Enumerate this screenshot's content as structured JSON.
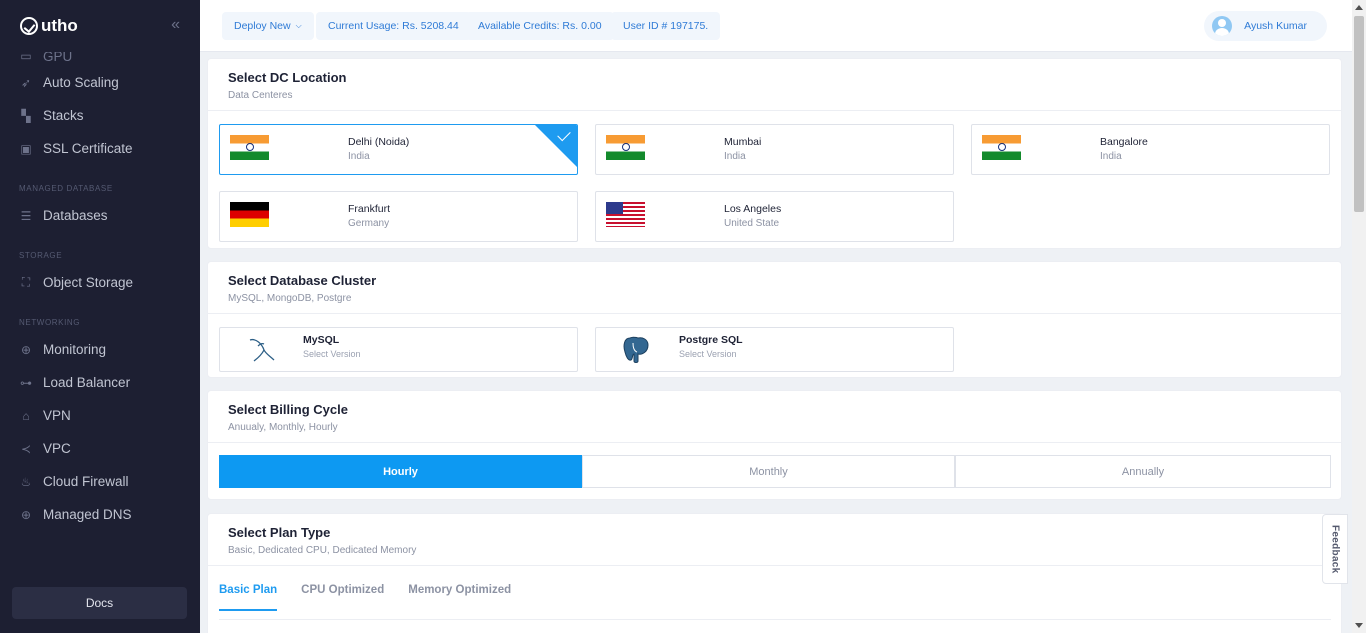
{
  "brand": {
    "name": "utho"
  },
  "sidebar": {
    "partial_item": "GPU",
    "items_top": [
      {
        "label": "Auto Scaling",
        "icon": "rocket-icon"
      },
      {
        "label": "Stacks",
        "icon": "stack-icon"
      },
      {
        "label": "SSL Certificate",
        "icon": "certificate-icon"
      }
    ],
    "sections": [
      {
        "title": "MANAGED DATABASE",
        "items": [
          {
            "label": "Databases",
            "icon": "database-icon"
          }
        ]
      },
      {
        "title": "STORAGE",
        "items": [
          {
            "label": "Object Storage",
            "icon": "storage-icon"
          }
        ]
      },
      {
        "title": "NETWORKING",
        "items": [
          {
            "label": "Monitoring",
            "icon": "globe-icon"
          },
          {
            "label": "Load Balancer",
            "icon": "hierarchy-icon"
          },
          {
            "label": "VPN",
            "icon": "lock-icon"
          },
          {
            "label": "VPC",
            "icon": "share-icon"
          },
          {
            "label": "Cloud Firewall",
            "icon": "firewall-icon"
          },
          {
            "label": "Managed DNS",
            "icon": "globe-icon"
          }
        ]
      }
    ],
    "docs_label": "Docs"
  },
  "topbar": {
    "deploy_label": "Deploy New",
    "usage_label": "Current Usage: Rs. 5208.44",
    "credits_label": "Available Credits: Rs. 0.00",
    "user_id_label": "User ID # 197175.",
    "user_name": "Ayush Kumar"
  },
  "dc_section": {
    "title": "Select DC Location",
    "subtitle": "Data Centeres",
    "locations": [
      {
        "city": "Delhi (Noida)",
        "country": "India",
        "flag": "india-flag",
        "selected": true
      },
      {
        "city": "Mumbai",
        "country": "India",
        "flag": "india-flag",
        "selected": false
      },
      {
        "city": "Bangalore",
        "country": "India",
        "flag": "india-flag",
        "selected": false
      },
      {
        "city": "Frankfurt",
        "country": "Germany",
        "flag": "germany-flag",
        "selected": false
      },
      {
        "city": "Los Angeles",
        "country": "United State",
        "flag": "usa-flag",
        "selected": false
      }
    ]
  },
  "db_section": {
    "title": "Select Database Cluster",
    "subtitle": "MySQL, MongoDB, Postgre",
    "options": [
      {
        "name": "MySQL",
        "sub": "Select Version",
        "icon": "mysql-dolphin-icon"
      },
      {
        "name": "Postgre SQL",
        "sub": "Select Version",
        "icon": "postgres-elephant-icon"
      }
    ]
  },
  "billing_section": {
    "title": "Select Billing Cycle",
    "subtitle": "Anuualy, Monthly, Hourly",
    "options": [
      "Hourly",
      "Monthly",
      "Annually"
    ],
    "active": "Hourly"
  },
  "plan_section": {
    "title": "Select Plan Type",
    "subtitle": "Basic, Dedicated CPU, Dedicated Memory",
    "tabs": [
      "Basic Plan",
      "CPU Optimized",
      "Memory Optimized"
    ],
    "active_tab": "Basic Plan"
  },
  "feedback_label": "Feedback",
  "colors": {
    "accent": "#0d99f2",
    "sidebar_bg": "#1d1f32"
  }
}
